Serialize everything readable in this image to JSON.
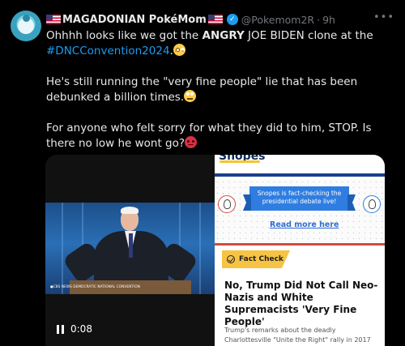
{
  "author": {
    "display_name": "MAGADONIAN PokéMom",
    "handle": "@Pokemom2R",
    "separator": "·",
    "time": "9h",
    "verified_icon": "verified-check-icon",
    "flag_icons": [
      "us-flag-icon",
      "us-flag-icon"
    ]
  },
  "menu": {
    "more_label": "•••"
  },
  "tweet": {
    "p1_before": "Ohhhh looks like we got the ",
    "p1_bold": "ANGRY",
    "p1_after": " JOE BIDEN clone at the ",
    "p1_hashtag": "#DNCConvention2024",
    "p1_end": ".",
    "p2": "He's still running the \"very fine people\" lie that has been debunked a billion times.",
    "p3": "For anyone who felt sorry for what they did to him, STOP. Is there no low he wont go?",
    "emojis": [
      "flushed-face-emoji",
      "face-with-rolling-eyes-emoji",
      "angry-face-emoji"
    ]
  },
  "video": {
    "time": "0:08",
    "overlay_text": "●CBS NEWS DEMOCRATIC NATIONAL CONVENTION",
    "pause_icon": "pause-icon"
  },
  "article": {
    "site_logo": "Snopes",
    "banner_text": "Snopes is fact-checking the presidential debate live!",
    "read_more": "Read more here",
    "tag": "Fact Check",
    "headline": "No, Trump Did Not Call Neo-Nazis and White Supremacists 'Very Fine People'",
    "summary": "Trump's remarks about the deadly Charlottesville \"Unite the Right\" rally in 2017"
  }
}
